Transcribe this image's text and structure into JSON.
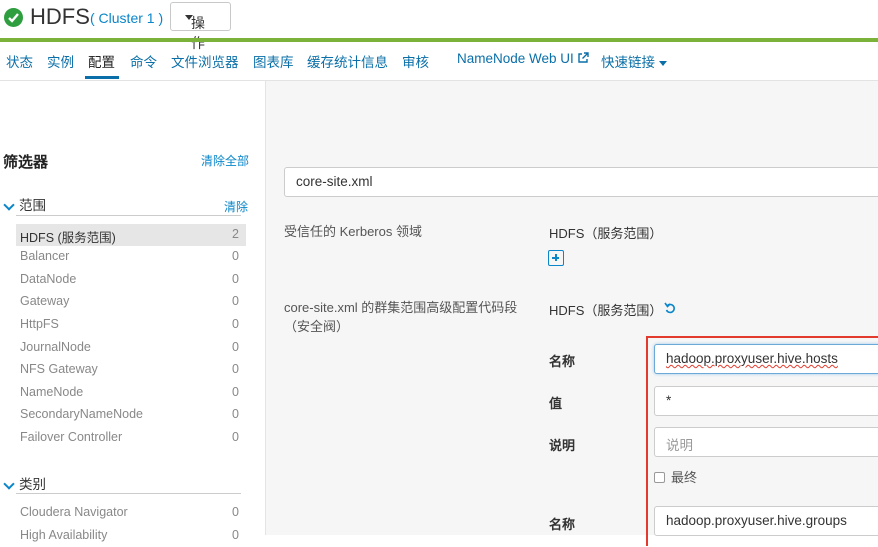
{
  "header": {
    "title": "HDFS",
    "cluster": "( Cluster 1 )",
    "actions_label": "操作"
  },
  "nav": {
    "items": [
      "状态",
      "实例",
      "配置",
      "命令",
      "文件浏览器",
      "图表库",
      "缓存统计信息",
      "审核",
      "NameNode Web UI",
      "快速链接"
    ],
    "active": "配置"
  },
  "sidebar": {
    "title": "筛选器",
    "clear_all": "清除全部",
    "scope": {
      "label": "范围",
      "clear": "清除",
      "items": [
        {
          "label": "HDFS (服务范围)",
          "count": "2"
        },
        {
          "label": "Balancer",
          "count": "0"
        },
        {
          "label": "DataNode",
          "count": "0"
        },
        {
          "label": "Gateway",
          "count": "0"
        },
        {
          "label": "HttpFS",
          "count": "0"
        },
        {
          "label": "JournalNode",
          "count": "0"
        },
        {
          "label": "NFS Gateway",
          "count": "0"
        },
        {
          "label": "NameNode",
          "count": "0"
        },
        {
          "label": "SecondaryNameNode",
          "count": "0"
        },
        {
          "label": "Failover Controller",
          "count": "0"
        }
      ]
    },
    "category": {
      "label": "类别",
      "items": [
        {
          "label": "Cloudera Navigator",
          "count": "0"
        },
        {
          "label": "High Availability",
          "count": "0"
        }
      ]
    }
  },
  "main": {
    "search_value": "core-site.xml",
    "prop1": {
      "label": "受信任的 Kerberos 领域",
      "scope": "HDFS（服务范围）"
    },
    "prop2": {
      "label_line1": "core-site.xml 的群集范围高级配置代码段",
      "label_line2": "（安全阀）",
      "scope": "HDFS（服务范围）"
    },
    "kv_labels": {
      "name": "名称",
      "value": "值",
      "description": "说明",
      "final": "最终"
    },
    "entry1": {
      "name": "hadoop.proxyuser.hive.hosts",
      "value": "*",
      "description_placeholder": "说明"
    },
    "entry2": {
      "name": "hadoop.proxyuser.hive.groups"
    }
  },
  "colors": {
    "accent": "#0a86c9",
    "status_green": "#2e9e3f",
    "top_bar_green": "#7bb33a",
    "highlight_red": "#e23b2e"
  }
}
